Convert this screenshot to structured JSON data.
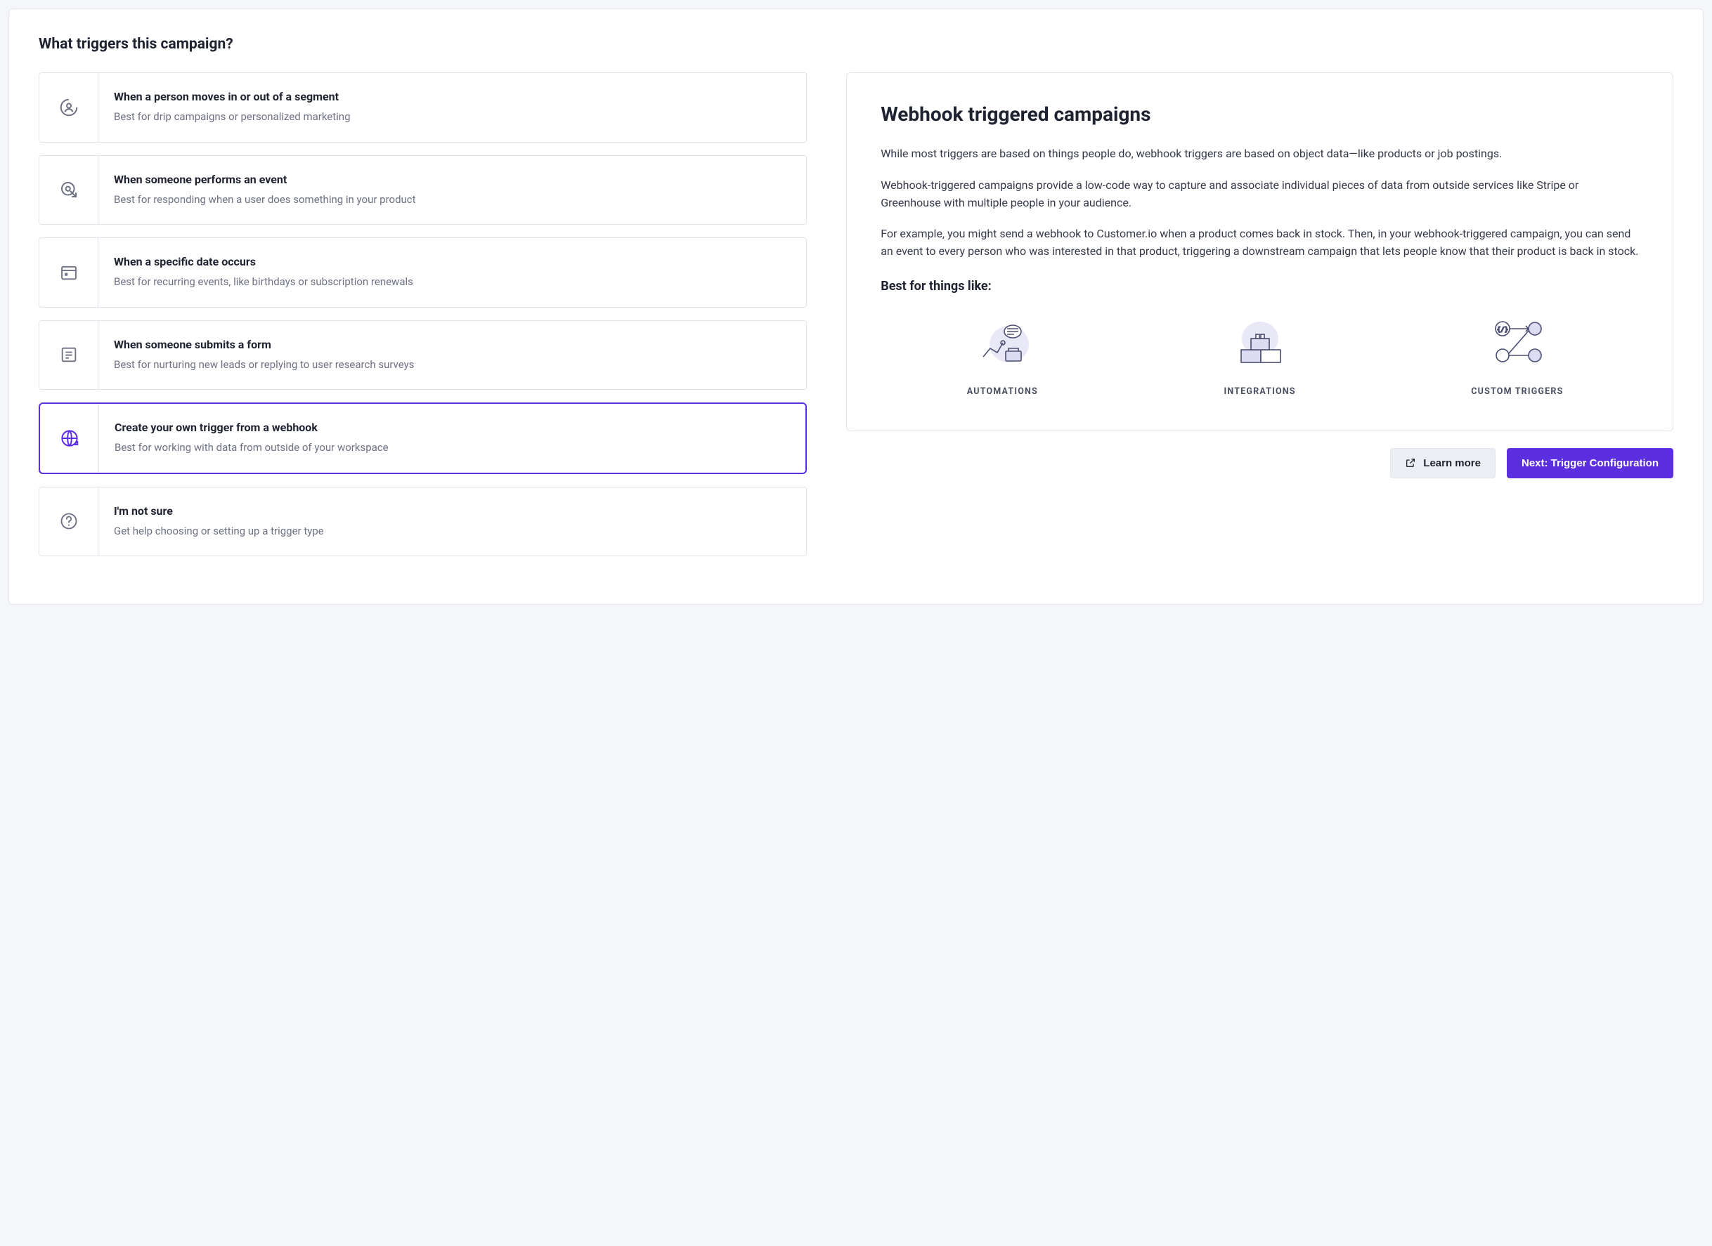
{
  "page_title": "What triggers this campaign?",
  "triggers": [
    {
      "title": "When a person moves in or out of a segment",
      "desc": "Best for drip campaigns or personalized marketing"
    },
    {
      "title": "When someone performs an event",
      "desc": "Best for responding when a user does something in your product"
    },
    {
      "title": "When a specific date occurs",
      "desc": "Best for recurring events, like birthdays or subscription renewals"
    },
    {
      "title": "When someone submits a form",
      "desc": "Best for nurturing new leads or replying to user research surveys"
    },
    {
      "title": "Create your own trigger from a webhook",
      "desc": "Best for working with data from outside of your workspace"
    },
    {
      "title": "I'm not sure",
      "desc": "Get help choosing or setting up a trigger type"
    }
  ],
  "selected_index": 4,
  "detail": {
    "title": "Webhook triggered campaigns",
    "para1": "While most triggers are based on things people do, webhook triggers are based on object data—like products or job postings.",
    "para2": "Webhook-triggered campaigns provide a low-code way to capture and associate individual pieces of data from outside services like Stripe or Greenhouse with multiple people in your audience.",
    "para3": "For example, you might send a webhook to Customer.io when a product comes back in stock. Then, in your webhook-triggered campaign, you can send an event to every person who was interested in that product, triggering a downstream campaign that lets people know that their product is back in stock.",
    "best_for_title": "Best for things like:",
    "best_for": {
      "automations": "AUTOMATIONS",
      "integrations": "INTEGRATIONS",
      "custom_triggers": "CUSTOM TRIGGERS"
    }
  },
  "actions": {
    "learn_more": "Learn more",
    "next": "Next: Trigger Configuration"
  }
}
